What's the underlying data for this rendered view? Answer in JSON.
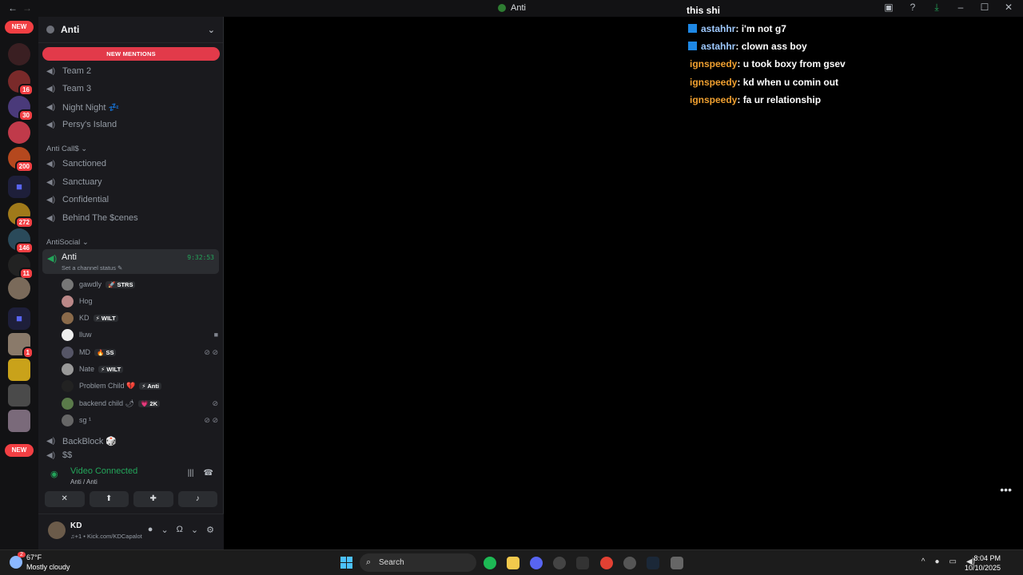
{
  "window": {
    "title": "Anti",
    "controls": {
      "minimize": "–",
      "maximize": "☐",
      "close": "✕"
    }
  },
  "guild_rail": {
    "top_pill": "NEW",
    "bottom_pill": "NEW",
    "badges": [
      "16",
      "30",
      "200",
      "272",
      "146",
      "11",
      "1"
    ]
  },
  "server": {
    "name": "Anti",
    "new_mentions": "NEW MENTIONS",
    "channels_top": [
      "Team 2",
      "Team 3",
      "Night Night 💤",
      "Persy's Island"
    ],
    "category_1": "Anti Call$ ⌄",
    "channels_mid": [
      "Sanctioned",
      "Sanctuary",
      "Confidential",
      "Behind The $cenes"
    ],
    "category_2": "AntiSocial ⌄",
    "active_channel": {
      "name": "Anti",
      "status": "Set a channel status ✎",
      "time": "9:32:53"
    },
    "voice_users": [
      {
        "name": "gawdly",
        "tag": "STRS",
        "tag_icon": "🚀"
      },
      {
        "name": "Hog",
        "tag": "",
        "tag_icon": ""
      },
      {
        "name": "KD",
        "tag": "WILT",
        "tag_icon": "⚡"
      },
      {
        "name": "lluw",
        "tag": "",
        "tag_icon": ""
      },
      {
        "name": "MD",
        "tag": "SS",
        "tag_icon": "🔥"
      },
      {
        "name": "Nate",
        "tag": "WILT",
        "tag_icon": "⚡"
      },
      {
        "name": "Problem Child 💔",
        "tag": "Anti",
        "tag_icon": "⚡"
      },
      {
        "name": "backend child 🌶",
        "tag": "2K",
        "tag_icon": "💗"
      },
      {
        "name": "sg ¹",
        "tag": "",
        "tag_icon": ""
      }
    ],
    "channels_bottom": [
      "BackBlock 🎲",
      "$$"
    ]
  },
  "voice_panel": {
    "title": "Video Connected",
    "subtitle": "Anti / Anti"
  },
  "user_panel": {
    "name": "KD",
    "status": "♫+1 • Kick.com/KDCapalot"
  },
  "chat": [
    {
      "user": "",
      "text": "this shi",
      "color": "#ffffff",
      "icon": false
    },
    {
      "user": "astahhr",
      "text": " : i'm not g7",
      "color": "#9ec9ff",
      "icon": true
    },
    {
      "user": "astahhr",
      "text": " : clown ass boy",
      "color": "#9ec9ff",
      "icon": true
    },
    {
      "user": "ignspeedy",
      "text": " : u took boxy from gsev",
      "color": "#f0a030",
      "icon": false
    },
    {
      "user": "ignspeedy",
      "text": " : kd when u comin out",
      "color": "#f0a030",
      "icon": false
    },
    {
      "user": "ignspeedy",
      "text": " : fa ur relationship",
      "color": "#f0a030",
      "icon": false
    }
  ],
  "taskbar": {
    "weather_temp": "67°F",
    "weather_desc": "Mostly cloudy",
    "weather_badge": "2",
    "search_placeholder": "Search",
    "time": "8:04 PM",
    "date": "10/10/2025"
  }
}
